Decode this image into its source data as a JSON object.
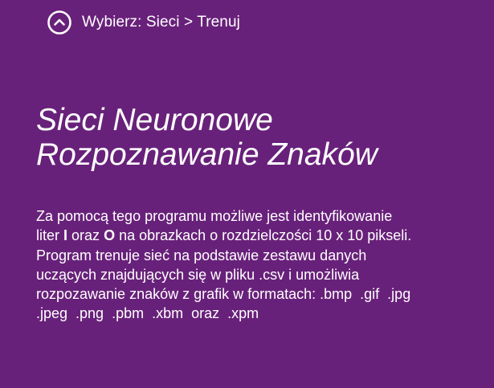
{
  "nav": {
    "back_icon": "chevron-up-circle-icon",
    "breadcrumb": "Wybierz: Sieci > Trenuj"
  },
  "header": {
    "title_line1": "Sieci Neuronowe",
    "title_line2": "Rozpoznawanie Znaków"
  },
  "description": {
    "l1": "Za pomocą tego programu możliwe jest identyfikowanie",
    "l2_a": "liter ",
    "l2_b": "I",
    "l2_c": " oraz ",
    "l2_d": "O",
    "l2_e": " na obrazkach o rozdzielczości 10 x 10 pikseli.",
    "l3": "Program trenuje sieć na podstawie zestawu danych",
    "l4": "uczących znajdujących się w pliku .csv i umożliwia",
    "l5": "rozpozawanie znaków z grafik w formatach: .bmp  .gif  .jpg",
    "l6": ".jpeg  .png  .pbm  .xbm  oraz  .xpm"
  },
  "colors": {
    "background": "#68217a",
    "text": "#ffffff"
  }
}
